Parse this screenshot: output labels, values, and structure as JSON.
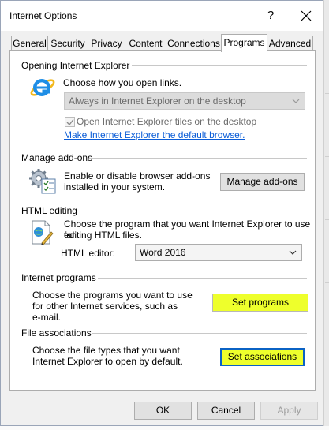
{
  "window": {
    "title": "Internet Options",
    "help_glyph": "?"
  },
  "tabs": [
    {
      "label": "General"
    },
    {
      "label": "Security"
    },
    {
      "label": "Privacy"
    },
    {
      "label": "Content"
    },
    {
      "label": "Connections"
    },
    {
      "label": "Programs"
    },
    {
      "label": "Advanced"
    }
  ],
  "active_tab": "Programs",
  "opening_ie": {
    "heading": "Opening Internet Explorer",
    "description": "Choose how you open links.",
    "select_value": "Always in Internet Explorer on the desktop",
    "checkbox_label": "Open Internet Explorer tiles on the desktop",
    "checkbox_checked": true,
    "default_link": "Make Internet Explorer the default browser."
  },
  "addons": {
    "heading": "Manage add-ons",
    "description_line1": "Enable or disable browser add-ons",
    "description_line2": "installed in your system.",
    "button": "Manage add-ons"
  },
  "html_editing": {
    "heading": "HTML editing",
    "description_line1": "Choose the program that you want Internet Explorer to use for",
    "description_line2": "editing HTML files.",
    "editor_label": "HTML editor:",
    "editor_value": "Word 2016"
  },
  "internet_programs": {
    "heading": "Internet programs",
    "description_line1": "Choose the programs you want to use",
    "description_line2": "for other Internet services, such as",
    "description_line3": "e-mail.",
    "button": "Set programs"
  },
  "file_assoc": {
    "heading": "File associations",
    "description_line1": "Choose the file types that you want",
    "description_line2": "Internet Explorer to open by default.",
    "button": "Set associations"
  },
  "footer": {
    "ok": "OK",
    "cancel": "Cancel",
    "apply": "Apply"
  },
  "colors": {
    "highlight": "#eeff2c",
    "link": "#0b5dd7",
    "focus_border": "#0b62c4"
  }
}
